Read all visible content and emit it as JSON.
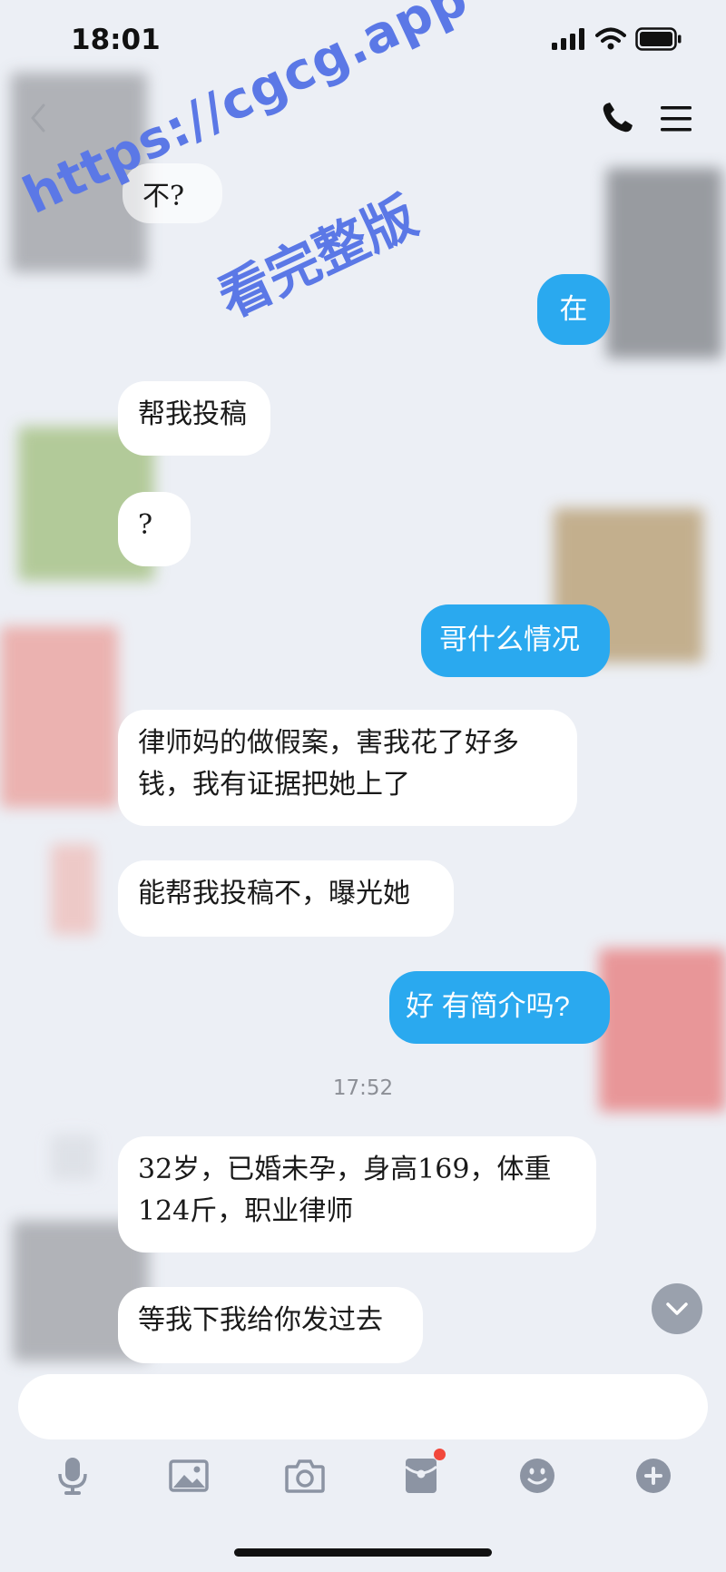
{
  "status_bar": {
    "time": "18:01"
  },
  "watermark": {
    "url": "https://cgcg.app",
    "slogan": "看完整版"
  },
  "messages": [
    {
      "side": "in",
      "text": "不?"
    },
    {
      "side": "out",
      "text": "在"
    },
    {
      "side": "in",
      "text": "帮我投稿"
    },
    {
      "side": "in",
      "text": "?"
    },
    {
      "side": "out",
      "text": "哥什么情况"
    },
    {
      "side": "in",
      "text": "律师妈的做假案，害我花了好多钱，我有证据把她上了"
    },
    {
      "side": "in",
      "text": "能帮我投稿不，曝光她"
    },
    {
      "side": "out",
      "text": "好 有简介吗?"
    },
    {
      "side": "in",
      "text": "32岁，已婚未孕，身高169，体重124斤，职业律师"
    },
    {
      "side": "in",
      "text": "等我下我给你发过去"
    }
  ],
  "timestamp": "17:52",
  "icons": {
    "back": "chevron-left-icon",
    "call": "phone-icon",
    "menu": "menu-icon",
    "scroll": "chevron-down-icon",
    "toolbar": [
      "microphone-icon",
      "image-icon",
      "camera-icon",
      "red-packet-icon",
      "emoji-icon",
      "plus-icon"
    ]
  },
  "colors": {
    "accent": "#2aa9ef",
    "watermark": "#5b78e6",
    "badge": "#f2483c"
  }
}
